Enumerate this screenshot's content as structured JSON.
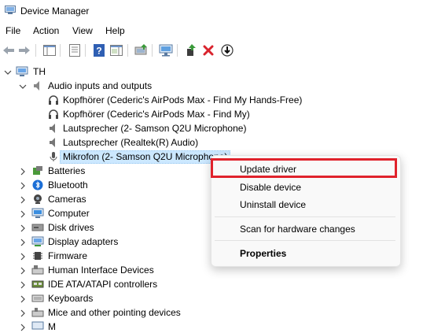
{
  "window": {
    "title": "Device Manager"
  },
  "menu": [
    "File",
    "Action",
    "View",
    "Help"
  ],
  "toolbar": {
    "icons": [
      "back-arrow-icon",
      "forward-arrow-icon",
      "show-hide-console-tree-icon",
      "properties-icon",
      "help-icon",
      "action-pane-icon",
      "update-driver-icon",
      "scan-hardware-icon",
      "enable-device-icon",
      "uninstall-device-icon",
      "disable-device-icon"
    ]
  },
  "tree": {
    "root": "TH",
    "audio_category": "Audio inputs and outputs",
    "audio_items": [
      "Kopfhörer (Cederic's AirPods Max - Find My Hands-Free)",
      "Kopfhörer (Cederic's AirPods Max - Find My)",
      "Lautsprecher (2- Samson Q2U Microphone)",
      "Lautsprecher (Realtek(R) Audio)",
      "Mikrofon (2- Samson Q2U Microphone)"
    ],
    "categories": [
      "Batteries",
      "Bluetooth",
      "Cameras",
      "Computer",
      "Disk drives",
      "Display adapters",
      "Firmware",
      "Human Interface Devices",
      "IDE ATA/ATAPI controllers",
      "Keyboards",
      "Mice and other pointing devices",
      "M"
    ]
  },
  "context_menu": {
    "update_driver": "Update driver",
    "disable_device": "Disable device",
    "uninstall_device": "Uninstall device",
    "scan_hardware": "Scan for hardware changes",
    "properties": "Properties"
  },
  "colors": {
    "highlight_border": "#e0222c",
    "selection": "#cce8ff",
    "uninstall_red": "#d9232d",
    "help_blue": "#2f5fb3"
  }
}
